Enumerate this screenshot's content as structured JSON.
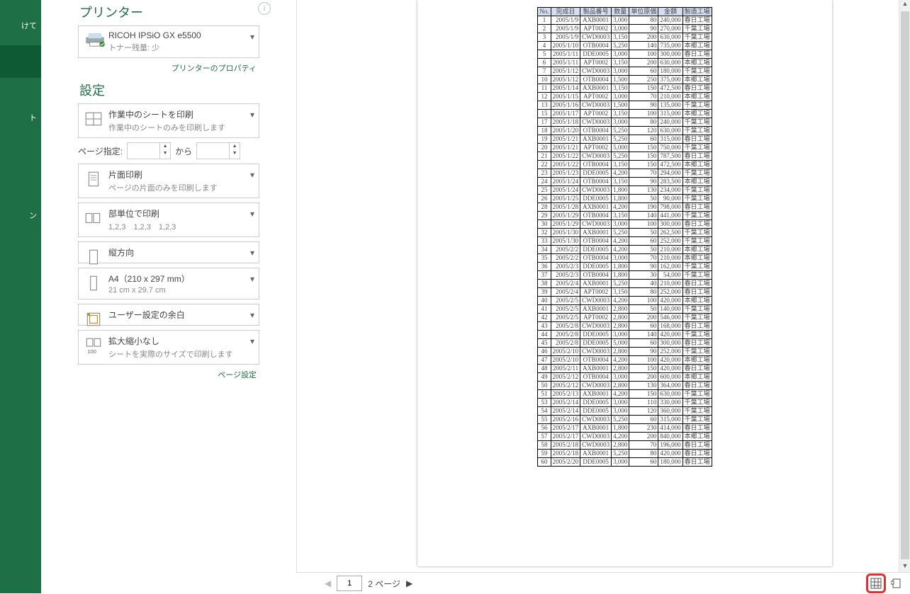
{
  "leftRail": {
    "item0": "けて",
    "item1": "",
    "item2": "ト",
    "item3": "ン"
  },
  "printer": {
    "section": "プリンター",
    "name": "RICOH IPSiO GX e5500",
    "status": "トナー残量: 少",
    "properties_link": "プリンターのプロパティ"
  },
  "settings": {
    "section": "設定",
    "what_print": {
      "t1": "作業中のシートを印刷",
      "t2": "作業中のシートのみを印刷します"
    },
    "page_spec": {
      "label": "ページ指定:",
      "to": "から"
    },
    "sides": {
      "t1": "片面印刷",
      "t2": "ページの片面のみを印刷します"
    },
    "collate": {
      "t1": "部単位で印刷",
      "t2": "1,2,3　1,2,3　1,2,3"
    },
    "orientation": {
      "t1": "縦方向"
    },
    "paper": {
      "t1": "A4（210 x 297 mm）",
      "t2": "21 cm x 29.7 cm"
    },
    "margins": {
      "t1": "ユーザー設定の余白"
    },
    "scaling": {
      "t1": "拡大縮小なし",
      "t2": "シートを実際のサイズで印刷します"
    },
    "page_setup_link": "ページ設定"
  },
  "preview_nav": {
    "page": "1",
    "total_label": "2 ページ",
    "prev": "◀",
    "next": "▶"
  },
  "scrollbar": {
    "up": "▲",
    "down": "▼"
  },
  "table": {
    "headers": [
      "No.",
      "完成日",
      "製品番号",
      "数量",
      "単位原価",
      "金額",
      "製造工場"
    ],
    "rows": [
      [
        "1",
        "2005/1/9",
        "AXB0001",
        "3,000",
        "80",
        "240,000",
        "春日工場"
      ],
      [
        "2",
        "2005/1/9",
        "APT0002",
        "3,000",
        "90",
        "270,000",
        "千葉工場"
      ],
      [
        "3",
        "2005/1/9",
        "CWD0003",
        "3,150",
        "200",
        "630,000",
        "千葉工場"
      ],
      [
        "4",
        "2005/1/10",
        "OTB0004",
        "5,250",
        "140",
        "735,000",
        "本郷工場"
      ],
      [
        "5",
        "2005/1/11",
        "DDE0005",
        "3,000",
        "100",
        "300,000",
        "春日工場"
      ],
      [
        "6",
        "2005/1/11",
        "APT0002",
        "3,150",
        "200",
        "630,000",
        "本郷工場"
      ],
      [
        "7",
        "2005/1/12",
        "CWD0003",
        "3,000",
        "60",
        "180,000",
        "千葉工場"
      ],
      [
        "10",
        "2005/1/12",
        "OTB0004",
        "1,500",
        "250",
        "375,000",
        "本郷工場"
      ],
      [
        "11",
        "2005/1/14",
        "AXB0001",
        "3,150",
        "150",
        "472,500",
        "春日工場"
      ],
      [
        "12",
        "2005/1/15",
        "APT0002",
        "3,000",
        "70",
        "210,000",
        "本郷工場"
      ],
      [
        "13",
        "2005/1/16",
        "CWD0003",
        "1,500",
        "90",
        "135,000",
        "千葉工場"
      ],
      [
        "15",
        "2005/1/17",
        "APT0002",
        "3,150",
        "100",
        "315,000",
        "本郷工場"
      ],
      [
        "17",
        "2005/1/18",
        "CWD0003",
        "3,000",
        "80",
        "240,000",
        "千葉工場"
      ],
      [
        "18",
        "2005/1/20",
        "OTB0004",
        "5,250",
        "120",
        "630,000",
        "千葉工場"
      ],
      [
        "19",
        "2005/1/21",
        "AXB0001",
        "5,250",
        "60",
        "315,000",
        "春日工場"
      ],
      [
        "20",
        "2005/1/21",
        "APT0002",
        "5,000",
        "150",
        "750,000",
        "千葉工場"
      ],
      [
        "21",
        "2005/1/22",
        "CWD0003",
        "5,250",
        "150",
        "787,500",
        "春日工場"
      ],
      [
        "22",
        "2005/1/22",
        "OTB0004",
        "3,150",
        "150",
        "472,500",
        "本郷工場"
      ],
      [
        "23",
        "2005/1/23",
        "DDE0005",
        "4,200",
        "70",
        "294,000",
        "千葉工場"
      ],
      [
        "24",
        "2005/1/24",
        "OTB0004",
        "3,150",
        "90",
        "283,500",
        "本郷工場"
      ],
      [
        "25",
        "2005/1/24",
        "CWD0003",
        "1,800",
        "130",
        "234,000",
        "千葉工場"
      ],
      [
        "26",
        "2005/1/25",
        "DDE0005",
        "1,800",
        "50",
        "90,000",
        "千葉工場"
      ],
      [
        "28",
        "2005/1/28",
        "AXB0001",
        "4,200",
        "190",
        "798,000",
        "春日工場"
      ],
      [
        "29",
        "2005/1/29",
        "OTB0004",
        "3,150",
        "140",
        "441,000",
        "千葉工場"
      ],
      [
        "30",
        "2005/1/29",
        "CWD0003",
        "3,000",
        "100",
        "300,000",
        "春日工場"
      ],
      [
        "32",
        "2005/1/30",
        "AXB0001",
        "5,250",
        "50",
        "262,500",
        "千葉工場"
      ],
      [
        "33",
        "2005/1/30",
        "OTB0004",
        "4,200",
        "60",
        "252,000",
        "千葉工場"
      ],
      [
        "34",
        "2005/2/2",
        "DDE0005",
        "4,200",
        "50",
        "210,000",
        "本郷工場"
      ],
      [
        "35",
        "2005/2/2",
        "OTB0004",
        "3,000",
        "70",
        "210,000",
        "本郷工場"
      ],
      [
        "36",
        "2005/2/3",
        "DDE0005",
        "1,800",
        "90",
        "162,000",
        "千葉工場"
      ],
      [
        "37",
        "2005/2/3",
        "OTB0004",
        "1,800",
        "30",
        "54,000",
        "千葉工場"
      ],
      [
        "38",
        "2005/2/4",
        "AXB0001",
        "5,250",
        "40",
        "210,000",
        "春日工場"
      ],
      [
        "39",
        "2005/2/4",
        "APT0002",
        "3,150",
        "80",
        "252,000",
        "春日工場"
      ],
      [
        "40",
        "2005/2/5",
        "CWD0003",
        "4,200",
        "100",
        "420,000",
        "本郷工場"
      ],
      [
        "41",
        "2005/2/5",
        "AXB0001",
        "2,800",
        "50",
        "140,000",
        "千葉工場"
      ],
      [
        "42",
        "2005/2/5",
        "APT0002",
        "2,800",
        "200",
        "546,000",
        "千葉工場"
      ],
      [
        "43",
        "2005/2/8",
        "CWD0003",
        "2,800",
        "60",
        "168,000",
        "春日工場"
      ],
      [
        "44",
        "2005/2/8",
        "DDE0005",
        "3,000",
        "140",
        "420,000",
        "千葉工場"
      ],
      [
        "45",
        "2005/2/8",
        "DDE0005",
        "5,000",
        "60",
        "300,000",
        "春日工場"
      ],
      [
        "46",
        "2005/2/10",
        "CWD0003",
        "2,800",
        "90",
        "252,000",
        "千葉工場"
      ],
      [
        "47",
        "2005/2/10",
        "OTB0004",
        "4,200",
        "100",
        "420,000",
        "本郷工場"
      ],
      [
        "48",
        "2005/2/11",
        "AXB0001",
        "2,800",
        "150",
        "420,000",
        "春日工場"
      ],
      [
        "49",
        "2005/2/12",
        "OTB0004",
        "3,000",
        "200",
        "600,000",
        "本郷工場"
      ],
      [
        "50",
        "2005/2/12",
        "CWD0003",
        "2,800",
        "130",
        "364,000",
        "春日工場"
      ],
      [
        "51",
        "2005/2/13",
        "AXB0001",
        "4,200",
        "150",
        "630,000",
        "千葉工場"
      ],
      [
        "53",
        "2005/2/14",
        "DDE0005",
        "3,000",
        "110",
        "330,000",
        "千葉工場"
      ],
      [
        "54",
        "2005/2/14",
        "DDE0005",
        "3,000",
        "120",
        "360,000",
        "千葉工場"
      ],
      [
        "55",
        "2005/2/16",
        "CWD0003",
        "5,250",
        "60",
        "315,000",
        "千葉工場"
      ],
      [
        "56",
        "2005/2/17",
        "AXB0001",
        "1,800",
        "230",
        "414,000",
        "春日工場"
      ],
      [
        "57",
        "2005/2/17",
        "CWD0003",
        "4,200",
        "200",
        "840,000",
        "本郷工場"
      ],
      [
        "58",
        "2005/2/18",
        "CWD0003",
        "2,800",
        "70",
        "196,000",
        "春日工場"
      ],
      [
        "59",
        "2005/2/18",
        "AXB0001",
        "5,250",
        "80",
        "420,000",
        "春日工場"
      ],
      [
        "60",
        "2005/2/20",
        "DDE0005",
        "3,000",
        "60",
        "180,000",
        "春日工場"
      ]
    ]
  }
}
